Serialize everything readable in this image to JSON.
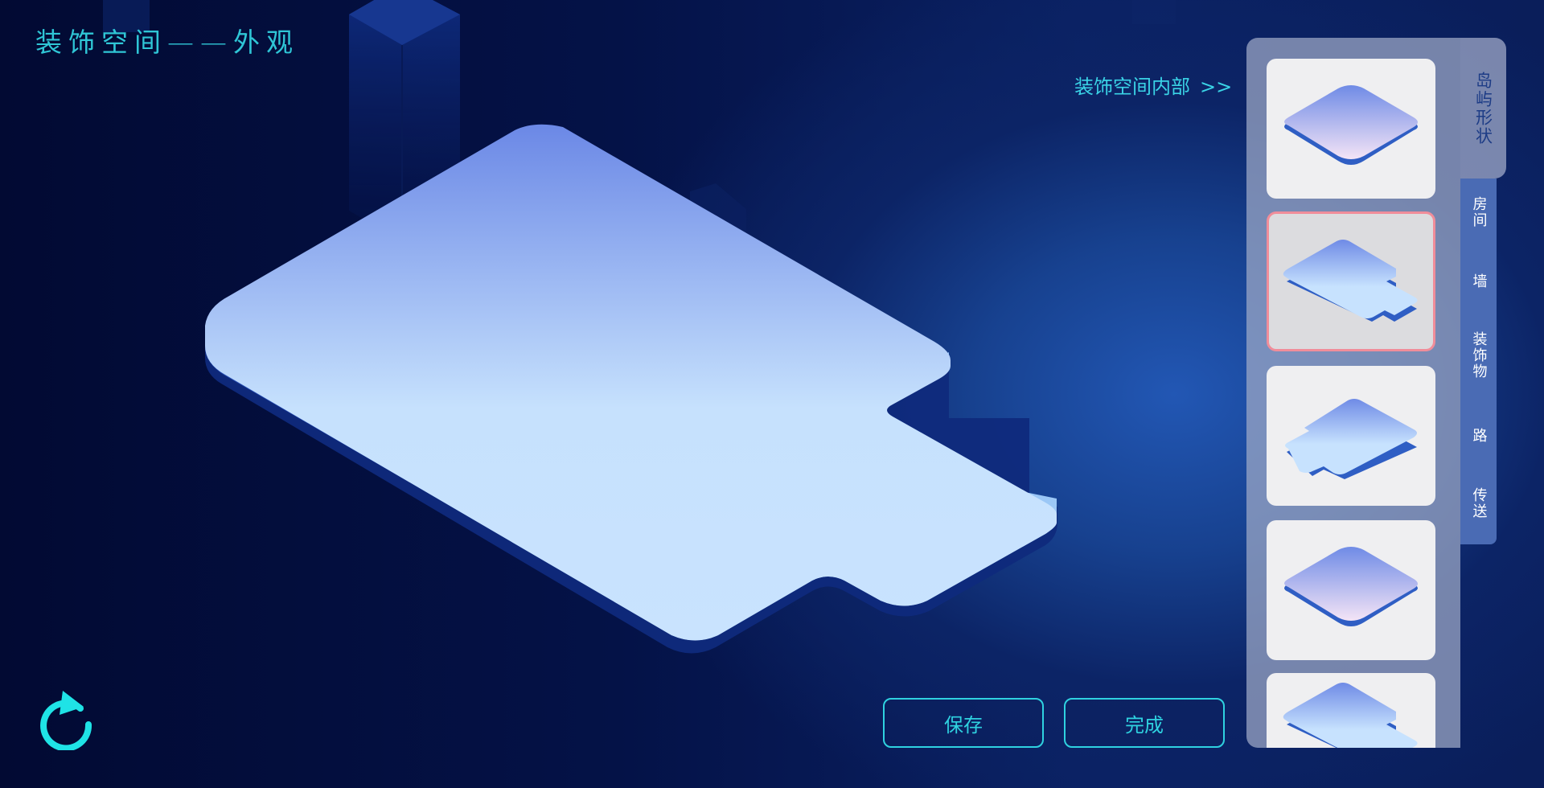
{
  "header": {
    "title": "装饰空间——外观",
    "inside_link_label": "装饰空间内部",
    "inside_link_chevron": ">>"
  },
  "sidebar": {
    "active_tab_label": "岛屿形状",
    "tabs": [
      {
        "label": "房间"
      },
      {
        "label": "墙"
      },
      {
        "label": "装饰物"
      },
      {
        "label": "路"
      },
      {
        "label": "传送"
      }
    ],
    "shapes": [
      {
        "shape": "rounded-diamond",
        "selected": false
      },
      {
        "shape": "notched-right",
        "selected": true
      },
      {
        "shape": "notched-left",
        "selected": false
      },
      {
        "shape": "rounded-diamond",
        "selected": false
      },
      {
        "shape": "notched-right",
        "selected": false
      }
    ]
  },
  "actions": {
    "save_label": "保存",
    "done_label": "完成"
  },
  "icons": {
    "refresh": "refresh-icon"
  },
  "colors": {
    "accent": "#2fd2e0",
    "selected_border": "#f08d9a",
    "island_top": "#6f8de8",
    "island_bottom": "#c7e2fe"
  }
}
